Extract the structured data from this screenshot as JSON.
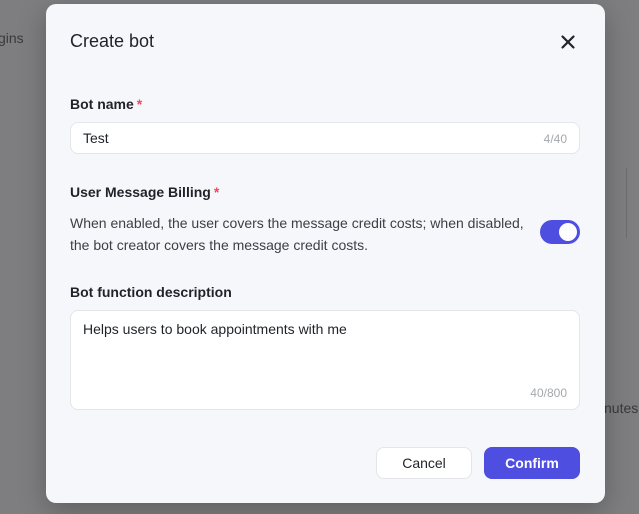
{
  "background": {
    "left_fragment": "gins",
    "right_fragment": "nutes"
  },
  "modal": {
    "title": "Create bot",
    "close_icon": "close-icon"
  },
  "bot_name": {
    "label": "Bot name",
    "required_mark": "*",
    "value": "Test",
    "counter": "4/40"
  },
  "billing": {
    "label": "User Message Billing",
    "required_mark": "*",
    "description": "When enabled, the user covers the message credit costs; when disabled, the bot creator covers the message credit costs.",
    "enabled": true
  },
  "description": {
    "label": "Bot function description",
    "value": "Helps users to book appointments with me",
    "counter": "40/800"
  },
  "footer": {
    "cancel_label": "Cancel",
    "confirm_label": "Confirm"
  },
  "colors": {
    "accent": "#4e4ee0",
    "required": "#f5485d"
  }
}
